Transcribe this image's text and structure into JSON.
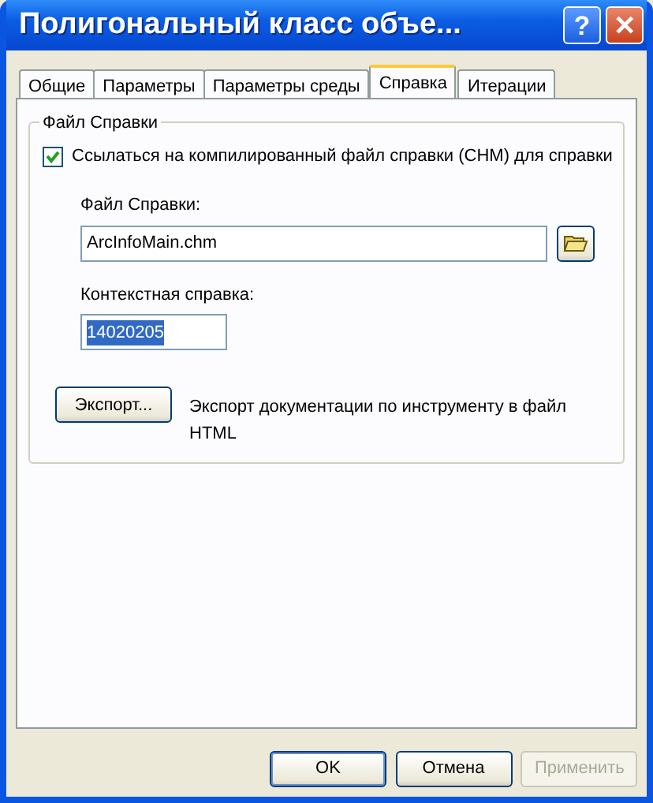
{
  "window": {
    "title": "Полигональный класс объе...",
    "buttons": [
      {
        "kind": "help",
        "label": "?"
      },
      {
        "kind": "close",
        "label": "✕"
      }
    ]
  },
  "tabs": [
    {
      "label": "Общие",
      "selected": false
    },
    {
      "label": "Параметры",
      "selected": false
    },
    {
      "label": "Параметры среды",
      "selected": false
    },
    {
      "label": "Справка",
      "selected": true
    },
    {
      "label": "Итерации",
      "selected": false
    }
  ],
  "group": {
    "title": "Файл Справки",
    "checkbox": {
      "label": "Ссылаться на компилированный файл справки (CHM) для справки",
      "checked": true
    },
    "fields": [
      {
        "label": "Файл Справки:",
        "value": "ArcInfoMain.chm",
        "selected": false,
        "browse": true
      },
      {
        "label": "Контекстная справка:",
        "value": "14020205",
        "selected": true,
        "browse": false
      }
    ],
    "export": {
      "button": "Экспорт...",
      "description": "Экспорт документации по инструменту в файл HTML"
    }
  },
  "buttons": [
    {
      "label": "OK",
      "default": true,
      "disabled": false
    },
    {
      "label": "Отмена",
      "default": false,
      "disabled": false
    },
    {
      "label": "Применить",
      "default": false,
      "disabled": true
    }
  ]
}
